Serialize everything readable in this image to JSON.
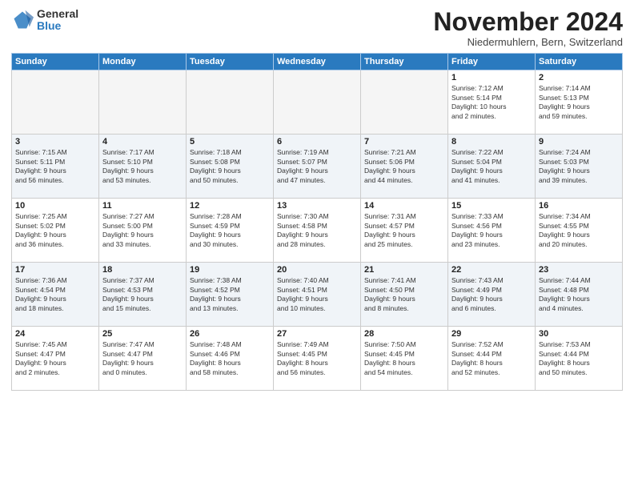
{
  "logo": {
    "general": "General",
    "blue": "Blue"
  },
  "header": {
    "month": "November 2024",
    "location": "Niedermuhlern, Bern, Switzerland"
  },
  "weekdays": [
    "Sunday",
    "Monday",
    "Tuesday",
    "Wednesday",
    "Thursday",
    "Friday",
    "Saturday"
  ],
  "weeks": [
    [
      {
        "day": "",
        "info": ""
      },
      {
        "day": "",
        "info": ""
      },
      {
        "day": "",
        "info": ""
      },
      {
        "day": "",
        "info": ""
      },
      {
        "day": "",
        "info": ""
      },
      {
        "day": "1",
        "info": "Sunrise: 7:12 AM\nSunset: 5:14 PM\nDaylight: 10 hours\nand 2 minutes."
      },
      {
        "day": "2",
        "info": "Sunrise: 7:14 AM\nSunset: 5:13 PM\nDaylight: 9 hours\nand 59 minutes."
      }
    ],
    [
      {
        "day": "3",
        "info": "Sunrise: 7:15 AM\nSunset: 5:11 PM\nDaylight: 9 hours\nand 56 minutes."
      },
      {
        "day": "4",
        "info": "Sunrise: 7:17 AM\nSunset: 5:10 PM\nDaylight: 9 hours\nand 53 minutes."
      },
      {
        "day": "5",
        "info": "Sunrise: 7:18 AM\nSunset: 5:08 PM\nDaylight: 9 hours\nand 50 minutes."
      },
      {
        "day": "6",
        "info": "Sunrise: 7:19 AM\nSunset: 5:07 PM\nDaylight: 9 hours\nand 47 minutes."
      },
      {
        "day": "7",
        "info": "Sunrise: 7:21 AM\nSunset: 5:06 PM\nDaylight: 9 hours\nand 44 minutes."
      },
      {
        "day": "8",
        "info": "Sunrise: 7:22 AM\nSunset: 5:04 PM\nDaylight: 9 hours\nand 41 minutes."
      },
      {
        "day": "9",
        "info": "Sunrise: 7:24 AM\nSunset: 5:03 PM\nDaylight: 9 hours\nand 39 minutes."
      }
    ],
    [
      {
        "day": "10",
        "info": "Sunrise: 7:25 AM\nSunset: 5:02 PM\nDaylight: 9 hours\nand 36 minutes."
      },
      {
        "day": "11",
        "info": "Sunrise: 7:27 AM\nSunset: 5:00 PM\nDaylight: 9 hours\nand 33 minutes."
      },
      {
        "day": "12",
        "info": "Sunrise: 7:28 AM\nSunset: 4:59 PM\nDaylight: 9 hours\nand 30 minutes."
      },
      {
        "day": "13",
        "info": "Sunrise: 7:30 AM\nSunset: 4:58 PM\nDaylight: 9 hours\nand 28 minutes."
      },
      {
        "day": "14",
        "info": "Sunrise: 7:31 AM\nSunset: 4:57 PM\nDaylight: 9 hours\nand 25 minutes."
      },
      {
        "day": "15",
        "info": "Sunrise: 7:33 AM\nSunset: 4:56 PM\nDaylight: 9 hours\nand 23 minutes."
      },
      {
        "day": "16",
        "info": "Sunrise: 7:34 AM\nSunset: 4:55 PM\nDaylight: 9 hours\nand 20 minutes."
      }
    ],
    [
      {
        "day": "17",
        "info": "Sunrise: 7:36 AM\nSunset: 4:54 PM\nDaylight: 9 hours\nand 18 minutes."
      },
      {
        "day": "18",
        "info": "Sunrise: 7:37 AM\nSunset: 4:53 PM\nDaylight: 9 hours\nand 15 minutes."
      },
      {
        "day": "19",
        "info": "Sunrise: 7:38 AM\nSunset: 4:52 PM\nDaylight: 9 hours\nand 13 minutes."
      },
      {
        "day": "20",
        "info": "Sunrise: 7:40 AM\nSunset: 4:51 PM\nDaylight: 9 hours\nand 10 minutes."
      },
      {
        "day": "21",
        "info": "Sunrise: 7:41 AM\nSunset: 4:50 PM\nDaylight: 9 hours\nand 8 minutes."
      },
      {
        "day": "22",
        "info": "Sunrise: 7:43 AM\nSunset: 4:49 PM\nDaylight: 9 hours\nand 6 minutes."
      },
      {
        "day": "23",
        "info": "Sunrise: 7:44 AM\nSunset: 4:48 PM\nDaylight: 9 hours\nand 4 minutes."
      }
    ],
    [
      {
        "day": "24",
        "info": "Sunrise: 7:45 AM\nSunset: 4:47 PM\nDaylight: 9 hours\nand 2 minutes."
      },
      {
        "day": "25",
        "info": "Sunrise: 7:47 AM\nSunset: 4:47 PM\nDaylight: 9 hours\nand 0 minutes."
      },
      {
        "day": "26",
        "info": "Sunrise: 7:48 AM\nSunset: 4:46 PM\nDaylight: 8 hours\nand 58 minutes."
      },
      {
        "day": "27",
        "info": "Sunrise: 7:49 AM\nSunset: 4:45 PM\nDaylight: 8 hours\nand 56 minutes."
      },
      {
        "day": "28",
        "info": "Sunrise: 7:50 AM\nSunset: 4:45 PM\nDaylight: 8 hours\nand 54 minutes."
      },
      {
        "day": "29",
        "info": "Sunrise: 7:52 AM\nSunset: 4:44 PM\nDaylight: 8 hours\nand 52 minutes."
      },
      {
        "day": "30",
        "info": "Sunrise: 7:53 AM\nSunset: 4:44 PM\nDaylight: 8 hours\nand 50 minutes."
      }
    ]
  ]
}
